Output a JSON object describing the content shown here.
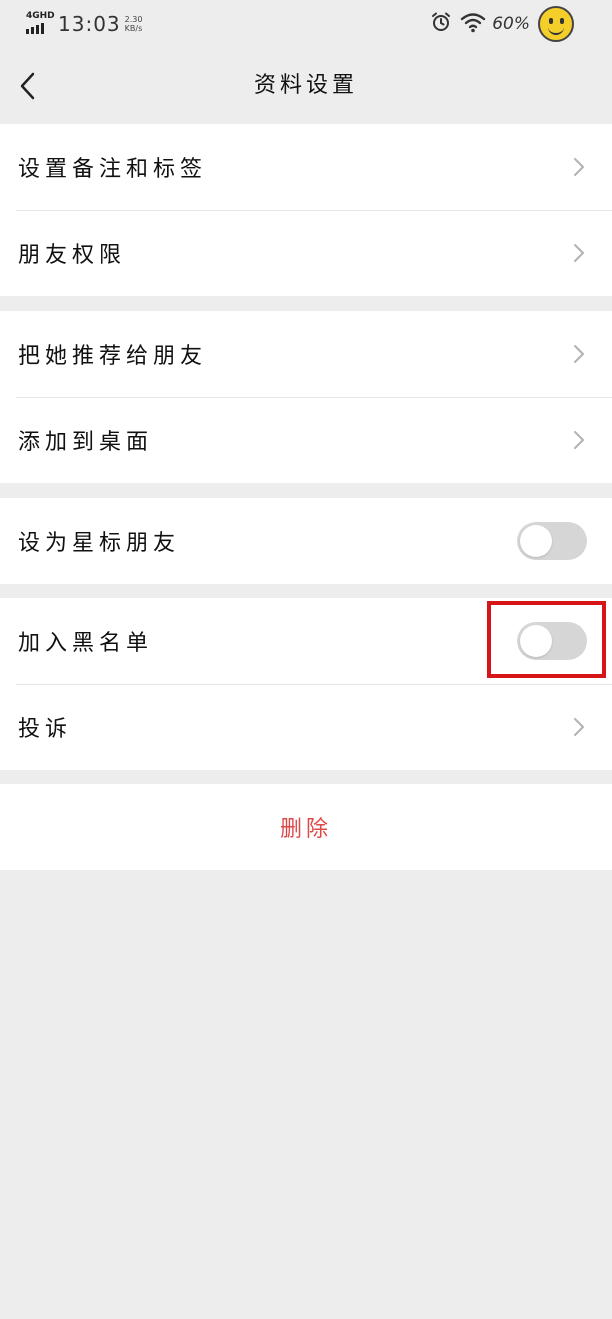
{
  "status_bar": {
    "network": "4GHD",
    "time": "13:03",
    "speed_value": "2.30",
    "speed_unit": "KB/s",
    "battery": "60%",
    "icons": [
      "alarm-icon",
      "wifi-icon",
      "smiley-icon"
    ]
  },
  "nav": {
    "title": "资料设置",
    "back_icon": "chevron-left-icon"
  },
  "groups": [
    {
      "items": [
        {
          "label": "设置备注和标签",
          "control": "chevron"
        },
        {
          "label": "朋友权限",
          "control": "chevron"
        }
      ]
    },
    {
      "items": [
        {
          "label": "把她推荐给朋友",
          "control": "chevron"
        },
        {
          "label": "添加到桌面",
          "control": "chevron"
        }
      ]
    },
    {
      "items": [
        {
          "label": "设为星标朋友",
          "control": "toggle",
          "on": false
        }
      ]
    },
    {
      "items": [
        {
          "label": "加入黑名单",
          "control": "toggle",
          "on": false
        },
        {
          "label": "投诉",
          "control": "chevron"
        }
      ]
    }
  ],
  "delete_label": "删除",
  "colors": {
    "background": "#ededed",
    "card": "#ffffff",
    "delete_text": "#e04848",
    "highlight": "#d71418",
    "toggle_off": "#d6d6d6"
  }
}
